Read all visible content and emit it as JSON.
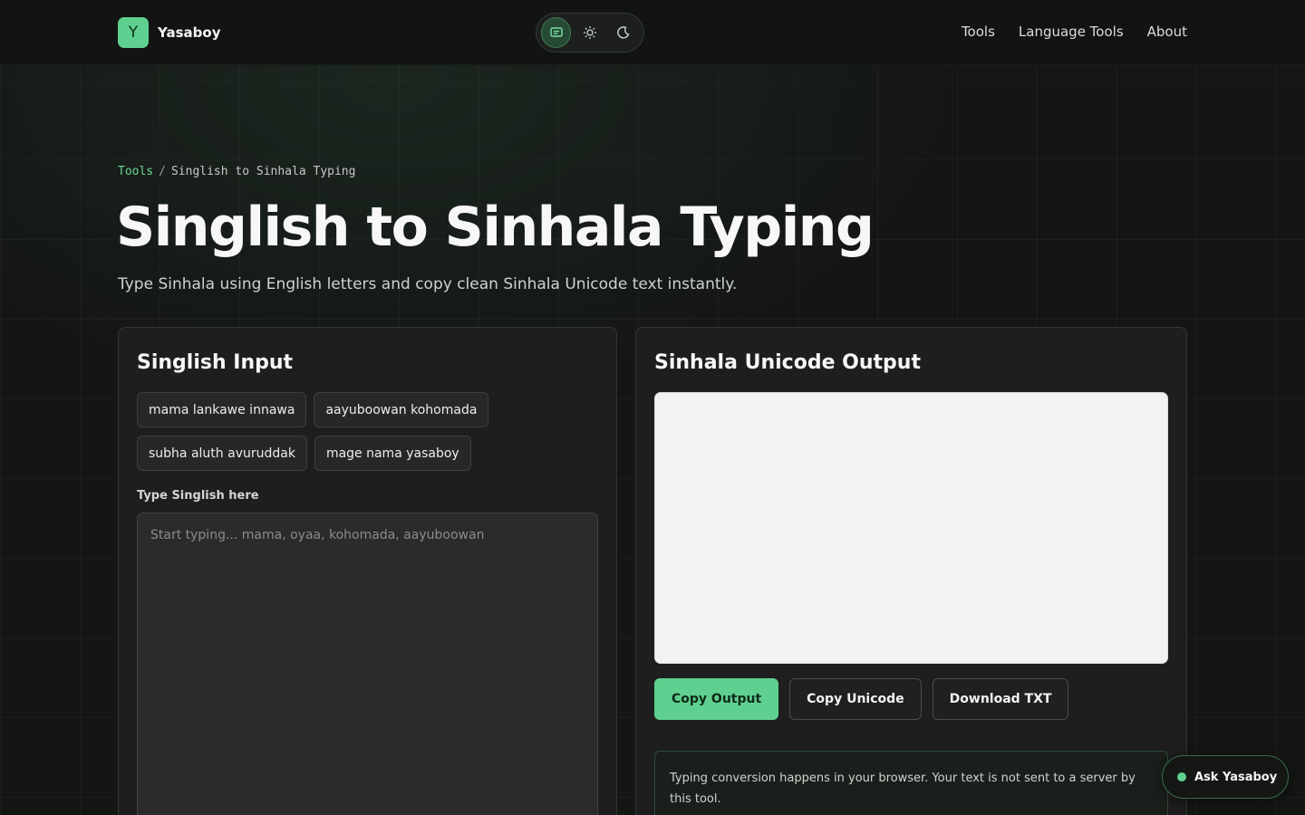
{
  "header": {
    "brand_initial": "Y",
    "brand_name": "Yasaboy",
    "theme_options": [
      "system-icon",
      "sun-icon",
      "moon-icon"
    ],
    "theme_selected": "system",
    "nav": [
      {
        "label": "Tools"
      },
      {
        "label": "Language Tools"
      },
      {
        "label": "About"
      }
    ]
  },
  "breadcrumb": {
    "root": "Tools",
    "separator": "/",
    "current": "Singlish to Sinhala Typing"
  },
  "hero": {
    "title": "Singlish to Sinhala Typing",
    "subtitle": "Type Sinhala using English letters and copy clean Sinhala Unicode text instantly."
  },
  "input_panel": {
    "title": "Singlish Input",
    "examples": [
      "mama lankawe innawa",
      "aayuboowan kohomada",
      "subha aluth avuruddak",
      "mage nama yasaboy"
    ],
    "field_label": "Type Singlish here",
    "placeholder": "Start typing... mama, oyaa, kohomada, aayuboowan",
    "value": ""
  },
  "output_panel": {
    "title": "Sinhala Unicode Output",
    "output_text": "",
    "buttons": {
      "copy_output": "Copy Output",
      "copy_unicode": "Copy Unicode",
      "download_txt": "Download TXT"
    },
    "privacy_note": "Typing conversion happens in your browser. Your text is not sent to a server by this tool."
  },
  "assistant": {
    "label": "Ask Yasaboy"
  },
  "colors": {
    "accent": "#5fd08f",
    "background": "#141614",
    "panel": "#1d1e1d"
  }
}
